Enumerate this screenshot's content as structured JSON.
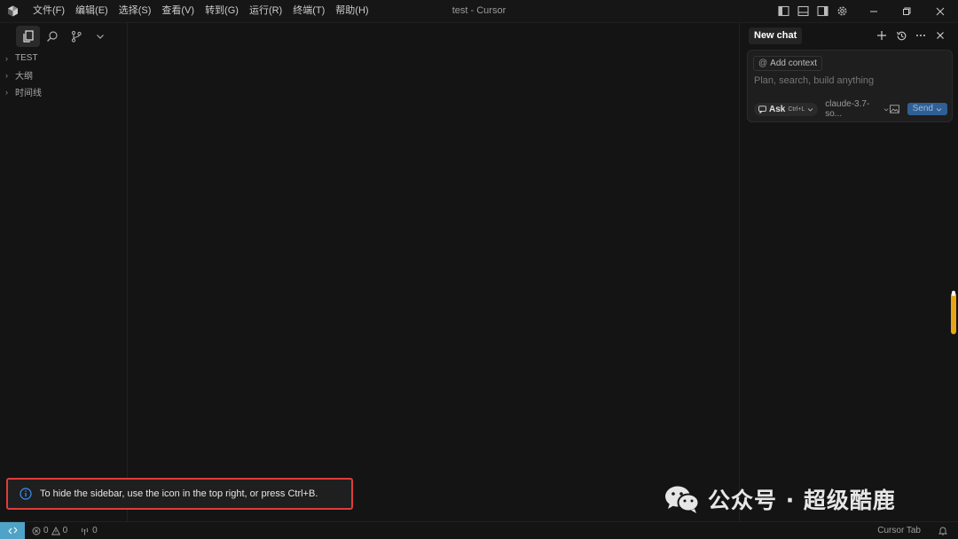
{
  "window": {
    "title": "test - Cursor"
  },
  "menu": [
    "文件(F)",
    "编辑(E)",
    "选择(S)",
    "查看(V)",
    "转到(G)",
    "运行(R)",
    "终端(T)",
    "帮助(H)"
  ],
  "explorer": {
    "tree": [
      {
        "label": "TEST"
      },
      {
        "label": "大纲"
      },
      {
        "label": "时间线"
      }
    ]
  },
  "chat": {
    "tab_label": "New chat",
    "add_context_label": "Add context",
    "input_placeholder": "Plan, search, build anything",
    "mode_label": "Ask",
    "mode_shortcut": "Ctrl+L",
    "model_label": "claude-3.7-so...",
    "send_label": "Send"
  },
  "notification": {
    "text": "To hide the sidebar, use the icon in the top right, or press Ctrl+B."
  },
  "watermark": {
    "text": "公众号 · 超级酷鹿"
  },
  "status": {
    "errors": "0",
    "warnings": "0",
    "ports": "0",
    "cursor_tab": "Cursor Tab"
  },
  "colors": {
    "accent": "#4fa3c7",
    "send": "#2f5f95",
    "highlight_border": "#e03b3b"
  }
}
